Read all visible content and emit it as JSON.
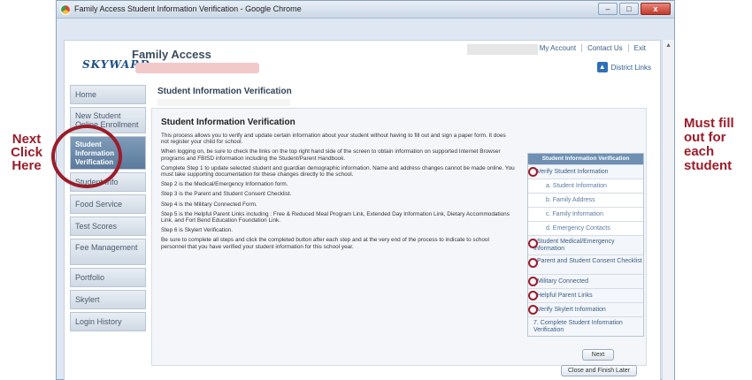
{
  "annotations": {
    "left_note": "Next Click Here",
    "right_note": "Must fill out for each student"
  },
  "window": {
    "title": "Family Access Student Information Verification - Google Chrome",
    "controls": [
      "–",
      "□",
      "x"
    ]
  },
  "header": {
    "brand": "SKYWARD",
    "app_name": "Family Access",
    "links": [
      "My Account",
      "Contact Us",
      "Exit"
    ],
    "district_links": "District Links"
  },
  "sidebar": {
    "items": [
      {
        "label": "Home"
      },
      {
        "label": "New Student Online Enrollment"
      },
      {
        "label": "Student Information Verification"
      },
      {
        "label": "Student Info"
      },
      {
        "label": "Food Service"
      },
      {
        "label": "Test Scores"
      },
      {
        "label": "Fee Management"
      },
      {
        "label": "Portfolio"
      },
      {
        "label": "Skylert"
      },
      {
        "label": "Login History"
      }
    ],
    "active": "Student Information Verification"
  },
  "main": {
    "title": "Student Information Verification",
    "heading": "Student Information Verification",
    "paragraphs": [
      "This process allows you to verify and update certain information about your student without having to fill out and sign a paper form. It does not register your child for school.",
      "When logging on, be sure to check the links on the top right hand side of the screen to obtain information on supported Internet Browser programs and FBISD information including the Student/Parent Handbook.",
      "Complete Step 1 to update selected student and guardian demographic information. Name and address changes cannot be made online. You must take supporting documentation for these changes directly to the school.",
      "Step 2 is the Medical/Emergency Information form.",
      "Step 3 is the Parent and Student Consent Checklist.",
      "Step 4 is the Military Connected Form.",
      "Step 5 is the Helpful Parent Links including : Free & Reduced Meal Program Link, Extended Day Information Link, Dietary Accommodations Link, and Fort Bend Education Foundation Link.",
      "Step 6 is Skylert Verification.",
      "Be sure to complete all steps and click the completed button after each step and at the very end of the process to indicate to school personnel that you have verified your student information for this school year."
    ]
  },
  "steps_panel": {
    "header": "Student Information Verification",
    "steps": [
      {
        "label": "Verify Student Information",
        "type": "main"
      },
      {
        "label": "a. Student Information",
        "type": "sub"
      },
      {
        "label": "b. Family Address",
        "type": "sub"
      },
      {
        "label": "c. Family Information",
        "type": "sub"
      },
      {
        "label": "d. Emergency Contacts",
        "type": "sub"
      },
      {
        "label": "Student Medical/Emergency Information",
        "type": "two"
      },
      {
        "label": "Parent and Student Consent Checklist",
        "type": "two"
      },
      {
        "label": "Military Connected",
        "type": "main"
      },
      {
        "label": "Helpful Parent Links",
        "type": "main"
      },
      {
        "label": "Verify Skylert Information",
        "type": "main"
      }
    ],
    "final_step": "7. Complete Student Information Verification",
    "next_button": "Next",
    "finish_button": "Close and Finish Later"
  }
}
